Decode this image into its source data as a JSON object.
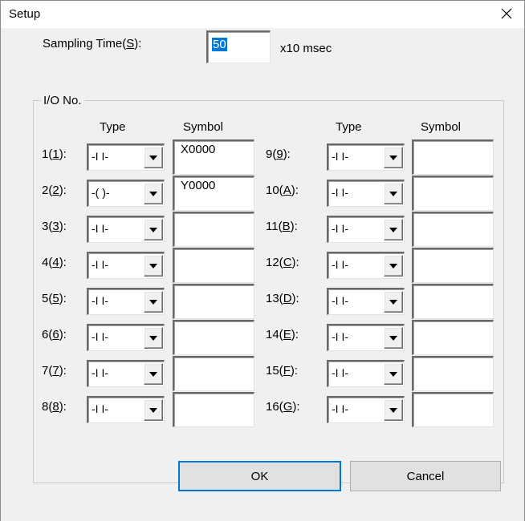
{
  "window": {
    "title": "Setup",
    "close_icon": "close-icon"
  },
  "sampling": {
    "label_pre": "Sampling Time(",
    "label_key": "S",
    "label_post": "):",
    "value": "50",
    "unit": "x10 msec"
  },
  "io_group": {
    "legend": "I/O No.",
    "type_header": "Type",
    "symbol_header": "Symbol",
    "rows_left": [
      {
        "num": "1(",
        "key": "1",
        "suffix": "):",
        "type": "-I I-",
        "symbol": "X0000"
      },
      {
        "num": "2(",
        "key": "2",
        "suffix": "):",
        "type": "-( )-",
        "symbol": "Y0000"
      },
      {
        "num": "3(",
        "key": "3",
        "suffix": "):",
        "type": "-I I-",
        "symbol": ""
      },
      {
        "num": "4(",
        "key": "4",
        "suffix": "):",
        "type": "-I I-",
        "symbol": ""
      },
      {
        "num": "5(",
        "key": "5",
        "suffix": "):",
        "type": "-I I-",
        "symbol": ""
      },
      {
        "num": "6(",
        "key": "6",
        "suffix": "):",
        "type": "-I I-",
        "symbol": ""
      },
      {
        "num": "7(",
        "key": "7",
        "suffix": "):",
        "type": "-I I-",
        "symbol": ""
      },
      {
        "num": "8(",
        "key": "8",
        "suffix": "):",
        "type": "-I I-",
        "symbol": ""
      }
    ],
    "rows_right": [
      {
        "num": "9(",
        "key": "9",
        "suffix": "):",
        "type": "-I I-",
        "symbol": ""
      },
      {
        "num": "10(",
        "key": "A",
        "suffix": "):",
        "type": "-I I-",
        "symbol": ""
      },
      {
        "num": "11(",
        "key": "B",
        "suffix": "):",
        "type": "-I I-",
        "symbol": ""
      },
      {
        "num": "12(",
        "key": "C",
        "suffix": "):",
        "type": "-I I-",
        "symbol": ""
      },
      {
        "num": "13(",
        "key": "D",
        "suffix": "):",
        "type": "-I I-",
        "symbol": ""
      },
      {
        "num": "14(",
        "key": "E",
        "suffix": "):",
        "type": "-I I-",
        "symbol": ""
      },
      {
        "num": "15(",
        "key": "F",
        "suffix": "):",
        "type": "-I I-",
        "symbol": ""
      },
      {
        "num": "16(",
        "key": "G",
        "suffix": "):",
        "type": "-I I-",
        "symbol": ""
      }
    ]
  },
  "buttons": {
    "ok": "OK",
    "cancel": "Cancel"
  },
  "colors": {
    "accent": "#0078d7",
    "face": "#f0f0f0"
  }
}
